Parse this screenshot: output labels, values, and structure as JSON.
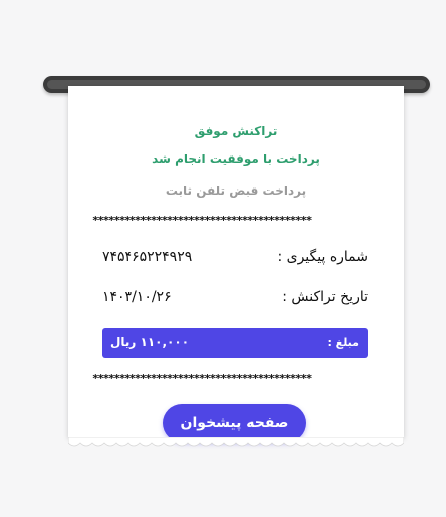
{
  "receipt": {
    "status_title": "تراکنش موفق",
    "status_message": "پرداخت با موفقیت انجام شد",
    "bill_type": "پرداخت قبض تلفن ثابت",
    "separator": "*****************************************",
    "tracking": {
      "label": "شماره پیگیری :",
      "value": "۷۴۵۴۶۵۲۲۴۹۲۹"
    },
    "date": {
      "label": "تاریخ تراکنش :",
      "value": "۱۴۰۳/۱۰/۲۶"
    },
    "amount": {
      "label": "مبلغ :",
      "value": "۱۱۰,۰۰۰ ریال"
    },
    "home_button_label": "صفحه پیشخوان"
  },
  "colors": {
    "accent": "#4f46e5",
    "success": "#2e9e6e",
    "muted": "#9a9a9a",
    "slot": "#3b3b3b"
  }
}
